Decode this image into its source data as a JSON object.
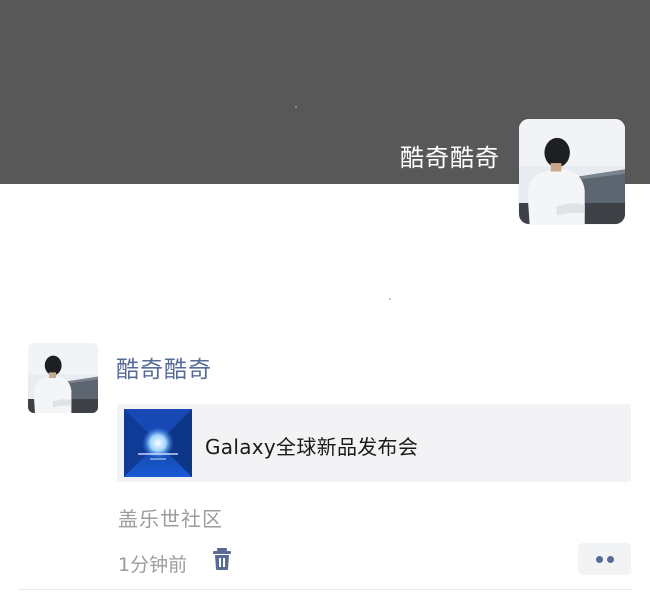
{
  "profile": {
    "name": "酷奇酷奇",
    "avatar_icon": "person-photo-icon"
  },
  "post": {
    "author": "酷奇酷奇",
    "link": {
      "title": "Galaxy全球新品发布会",
      "thumbnail_icon": "galaxy-event-thumbnail"
    },
    "source": "盖乐世社区",
    "time": "1分钟前",
    "delete_icon": "trash-icon",
    "more_icon": "more-dots-icon"
  },
  "colors": {
    "cover": "#585858",
    "name_link": "#576b95",
    "meta_text": "#9c9c9c",
    "card_bg": "#f3f3f5"
  }
}
